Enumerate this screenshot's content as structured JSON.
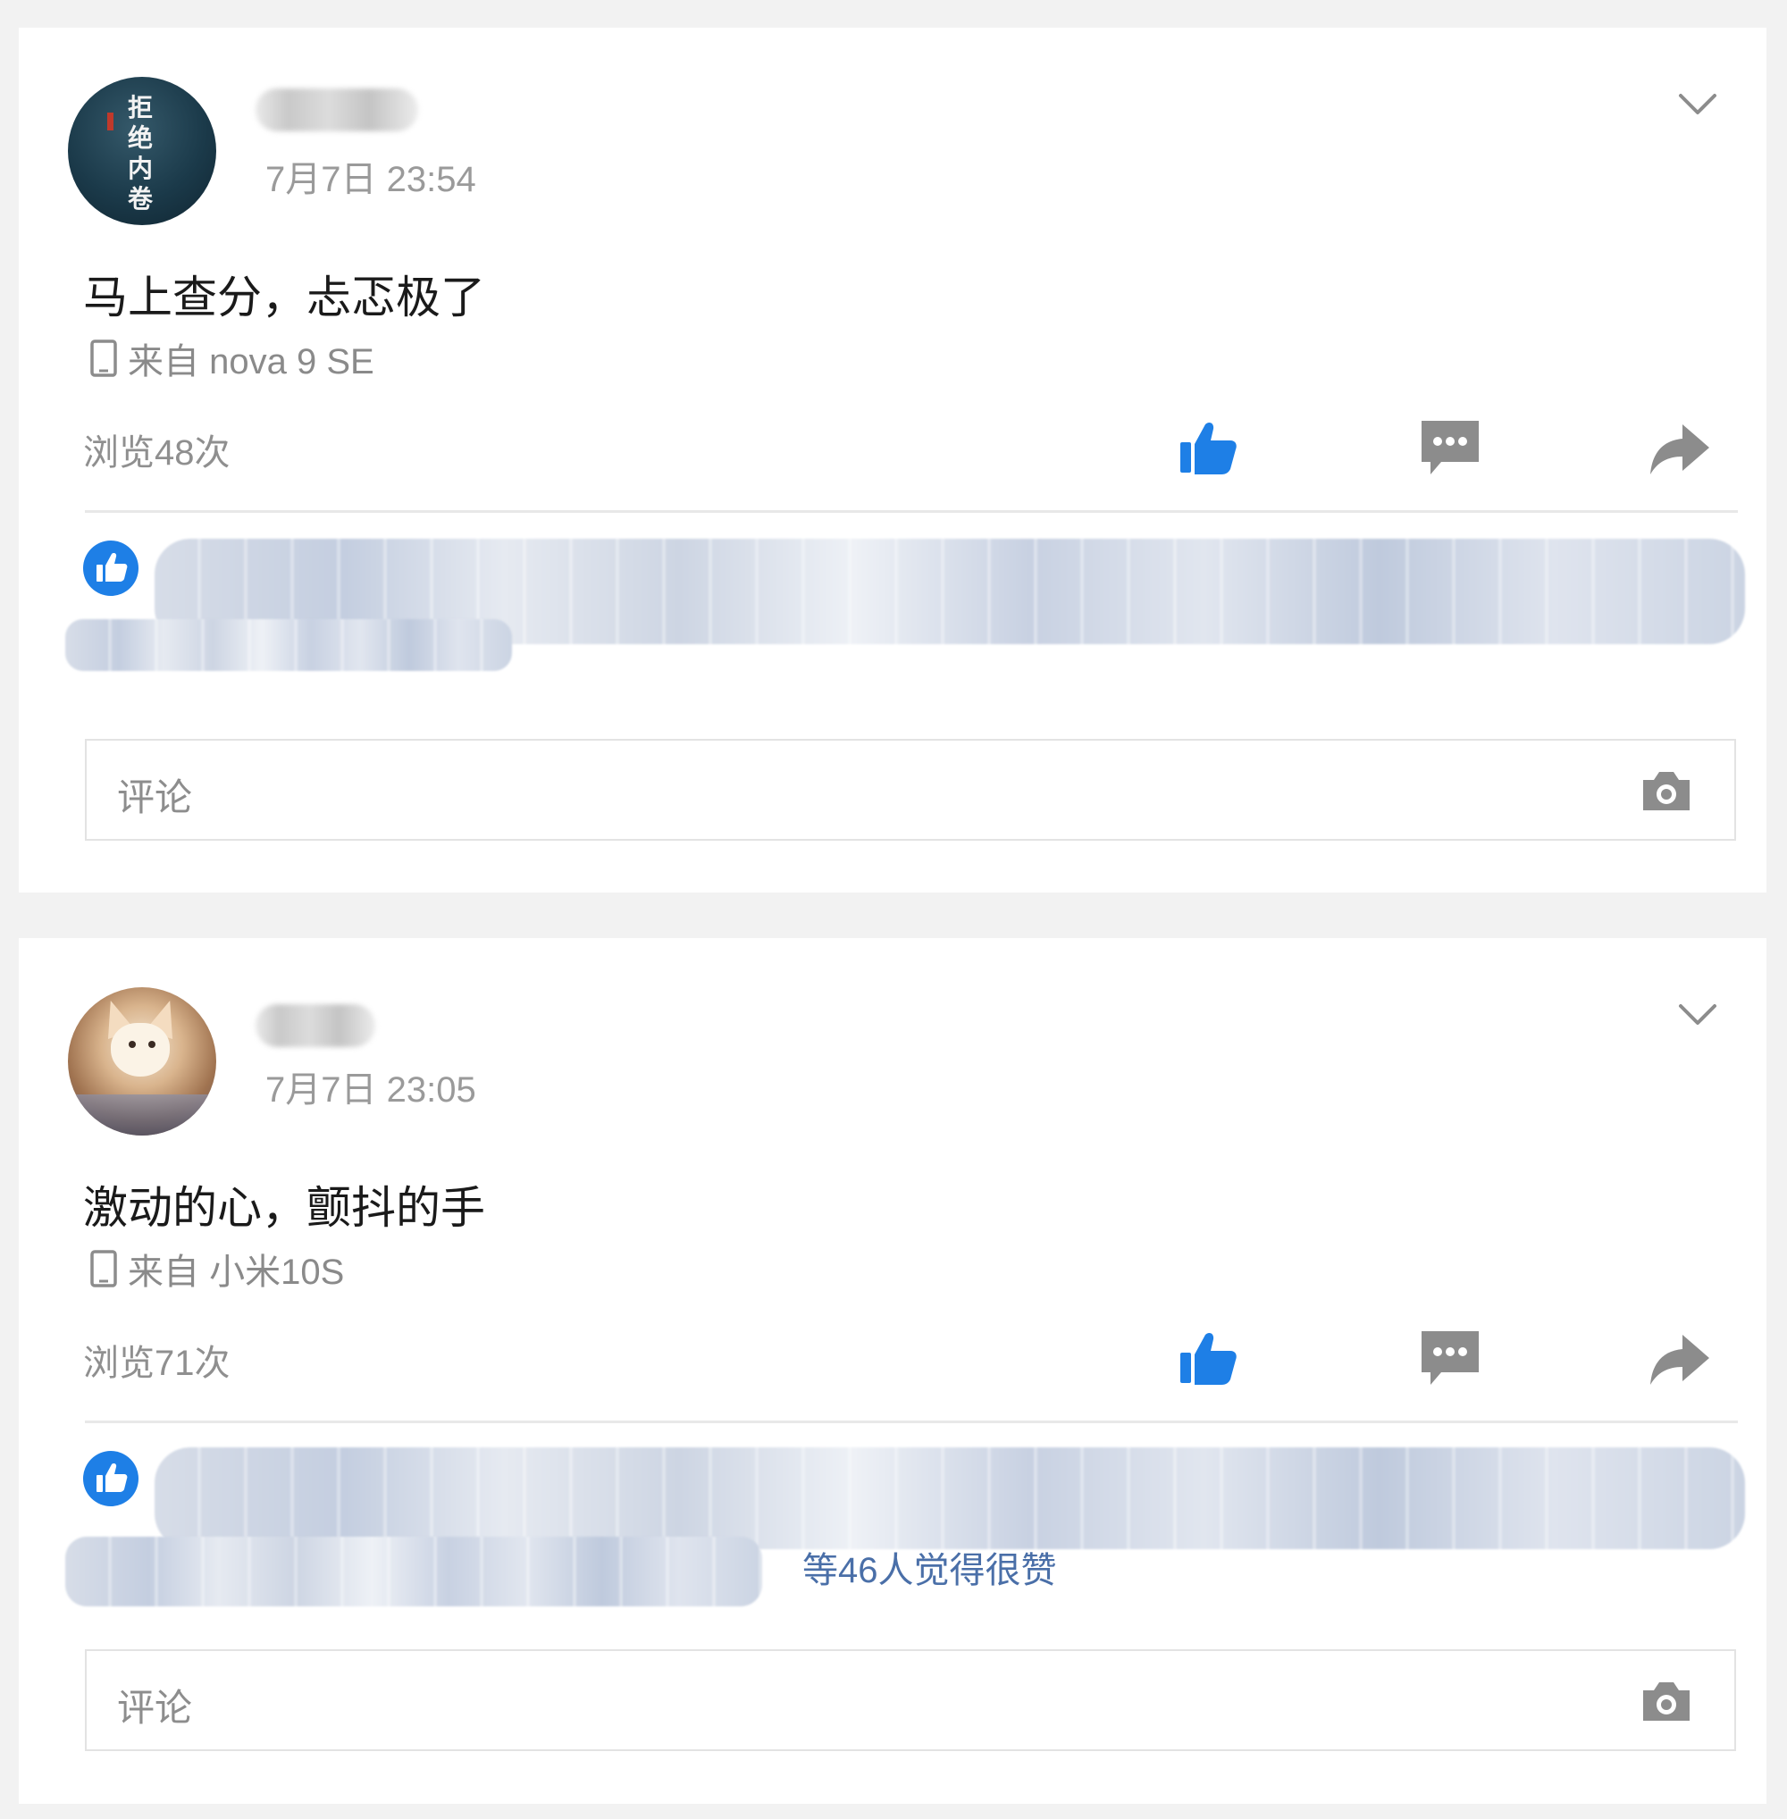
{
  "posts": [
    {
      "time": "7月7日 23:54",
      "text": "马上查分，忐忑极了",
      "source": "来自 nova 9 SE",
      "views": "浏览48次",
      "likes_text": "",
      "avatar_text": "拒绝内卷",
      "comment_placeholder": "评论"
    },
    {
      "time": "7月7日 23:05",
      "text": "激动的心，颤抖的手",
      "source": "来自 小米10S",
      "views": "浏览71次",
      "likes_text": "等46人觉得很赞",
      "avatar_text": "",
      "comment_placeholder": "评论"
    }
  ],
  "colors": {
    "accent": "#1e7fe6",
    "icon_gray": "#8c8c8c",
    "card_bg": "#ffffff",
    "page_bg": "#f2f2f2",
    "link": "#4a6fa8"
  },
  "icons": [
    "chevron-down-icon",
    "phone-icon",
    "thumbs-up-icon",
    "comment-icon",
    "share-icon",
    "camera-icon"
  ]
}
